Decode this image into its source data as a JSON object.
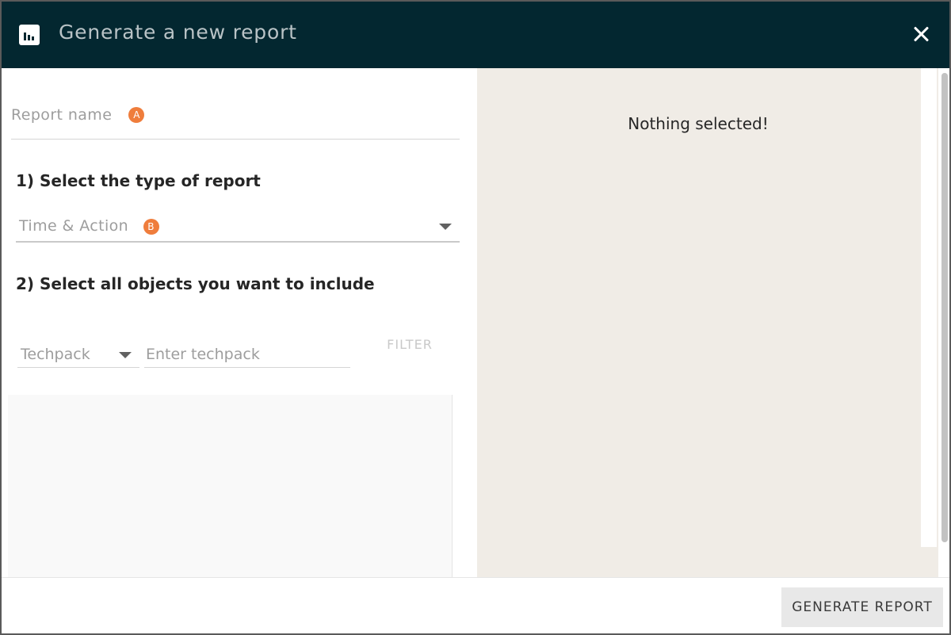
{
  "header": {
    "title": "Generate a new report",
    "icon": "bar-chart-icon",
    "close_icon": "close-icon"
  },
  "form": {
    "report_name": {
      "placeholder": "Report name",
      "badge": "A"
    },
    "step1_label": "1) Select the type of report",
    "report_type": {
      "value": "Time & Action",
      "badge": "B"
    },
    "step2_label": "2) Select all objects you want to include",
    "object_type": {
      "value": "Techpack"
    },
    "search": {
      "placeholder": "Enter techpack",
      "value": ""
    },
    "filter_label": "FILTER"
  },
  "selection": {
    "empty_text": "Nothing selected!"
  },
  "footer": {
    "generate_label": "GENERATE REPORT"
  },
  "colors": {
    "header_bg": "#032730",
    "badge": "#ef7d3c",
    "right_panel_bg": "#f0ece6"
  }
}
